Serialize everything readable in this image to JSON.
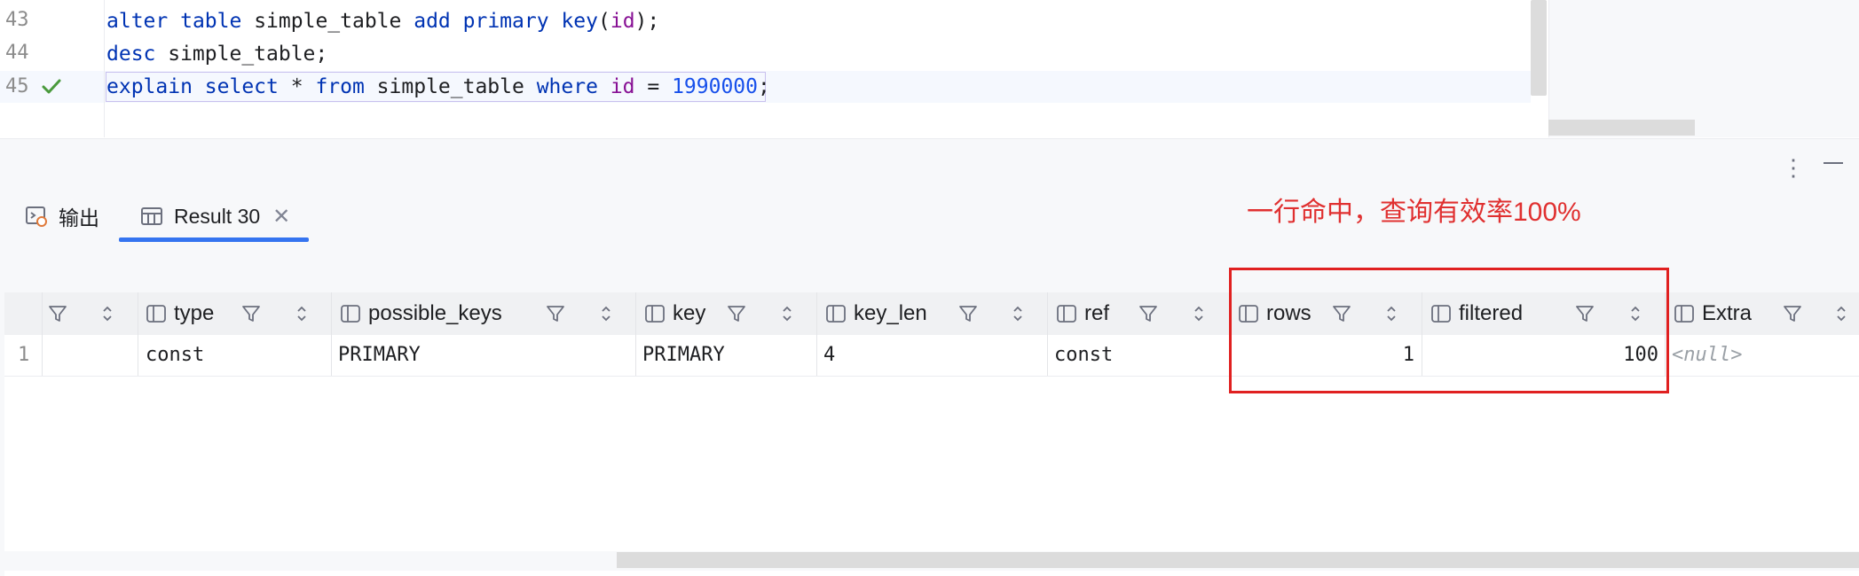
{
  "editor": {
    "lines": [
      {
        "num": "43",
        "tokens": [
          [
            "kw",
            "alter"
          ],
          [
            "txt",
            " "
          ],
          [
            "kw",
            "table"
          ],
          [
            "txt",
            " simple_table "
          ],
          [
            "kw",
            "add"
          ],
          [
            "txt",
            " "
          ],
          [
            "kw",
            "primary"
          ],
          [
            "txt",
            " "
          ],
          [
            "fn",
            "key"
          ],
          [
            "txt",
            "("
          ],
          [
            "col",
            "id"
          ],
          [
            "txt",
            ");"
          ]
        ]
      },
      {
        "num": "44",
        "tokens": [
          [
            "kw",
            "desc"
          ],
          [
            "txt",
            " simple_table;"
          ]
        ]
      },
      {
        "num": "45",
        "tokens": [
          [
            "kw",
            "explain"
          ],
          [
            "txt",
            " "
          ],
          [
            "kw",
            "select"
          ],
          [
            "txt",
            " * "
          ],
          [
            "kw",
            "from"
          ],
          [
            "txt",
            " simple_table "
          ],
          [
            "kw",
            "where"
          ],
          [
            "txt",
            " "
          ],
          [
            "col",
            "id"
          ],
          [
            "txt",
            " = "
          ],
          [
            "num",
            "1990000"
          ],
          [
            "txt",
            ";"
          ]
        ]
      }
    ]
  },
  "tabs": {
    "output": "输出",
    "result": "Result 30"
  },
  "annotation": "一行命中，查询有效率100%",
  "grid": {
    "columns": [
      "type",
      "possible_keys",
      "key",
      "key_len",
      "ref",
      "rows",
      "filtered",
      "Extra"
    ],
    "row": {
      "num": "1",
      "type": "const",
      "possible_keys": "PRIMARY",
      "key": "PRIMARY",
      "key_len": "4",
      "ref": "const",
      "rows": "1",
      "filtered": "100",
      "extra": "<null>"
    }
  },
  "colors": {
    "keyword": "#0033b3",
    "column": "#871094",
    "number": "#1750eb",
    "accent": "#3574f0",
    "annotation": "#e03030"
  }
}
